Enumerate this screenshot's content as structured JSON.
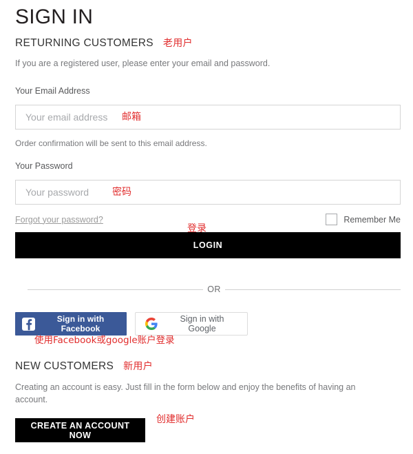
{
  "page": {
    "title": "SIGN IN"
  },
  "returning": {
    "heading": "RETURNING CUSTOMERS",
    "heading_annotation": "老用户",
    "intro": "If you are a registered user, please enter your email and password.",
    "email": {
      "label": "Your Email Address",
      "placeholder": "Your email address",
      "value": "",
      "annotation": "邮箱",
      "help": "Order confirmation will be sent to this email address."
    },
    "password": {
      "label": "Your Password",
      "placeholder": "Your password",
      "value": "",
      "annotation": "密码"
    },
    "forgot_link": "Forgot your password?",
    "remember_label": "Remember Me",
    "remember_checked": false,
    "login_button": "LOGIN",
    "login_annotation": "登录"
  },
  "divider": {
    "or_text": "OR"
  },
  "social": {
    "facebook": {
      "label": "Sign in with Facebook",
      "icon": "facebook-icon",
      "color": "#3b5998"
    },
    "google": {
      "label": "Sign in with Google",
      "icon": "google-icon",
      "color": "#ffffff"
    },
    "annotation": "使用Facebook或google账户登录"
  },
  "new_customers": {
    "heading": "NEW CUSTOMERS",
    "heading_annotation": "新用户",
    "description": "Creating an account is easy. Just fill in the form below and enjoy the benefits of having an account.",
    "create_button": "CREATE AN ACCOUNT NOW",
    "create_annotation": "创建账户"
  },
  "colors": {
    "accent_red": "#e12d2d",
    "facebook_blue": "#3b5998",
    "button_black": "#000000",
    "border_grey": "#d4d4d4",
    "text_grey": "#77787b"
  }
}
